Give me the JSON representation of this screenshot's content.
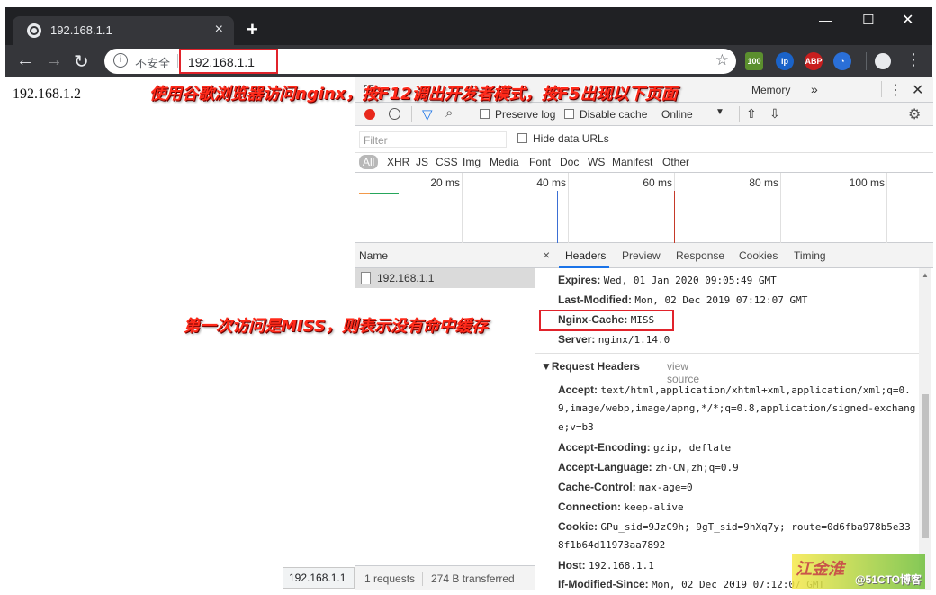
{
  "browser": {
    "tab_title": "192.168.1.1",
    "tab_close": "×",
    "new_tab": "+",
    "win_min": "—",
    "win_max": "☐",
    "win_close": "✕",
    "insecure_label": "不安全",
    "url": "192.168.1.1",
    "star": "☆",
    "ext_labels": [
      "100",
      "ip",
      "ABP",
      "◔"
    ],
    "menu": "⋮",
    "account": "●"
  },
  "page": {
    "content_text": "192.168.1.2",
    "status_link": "192.168.1.1"
  },
  "devtools": {
    "tabs_visible": [
      "Memory",
      "»"
    ],
    "toolbar": {
      "preserve_log": "Preserve log",
      "disable_cache": "Disable cache",
      "throttle": "Online"
    },
    "filter": {
      "placeholder": "Filter",
      "hide_data_urls": "Hide data URLs"
    },
    "types": [
      "All",
      "XHR",
      "JS",
      "CSS",
      "Img",
      "Media",
      "Font",
      "Doc",
      "WS",
      "Manifest",
      "Other"
    ],
    "timeline_ticks": [
      "20 ms",
      "40 ms",
      "60 ms",
      "80 ms",
      "100 ms"
    ],
    "name_header": "Name",
    "request_name": "192.168.1.1",
    "summary_requests": "1 requests",
    "summary_transferred": "274 B transferred",
    "detail_tabs": [
      "Headers",
      "Preview",
      "Response",
      "Cookies",
      "Timing"
    ],
    "response_headers": [
      {
        "key": "Expires:",
        "value": "Wed, 01 Jan 2020 09:05:49 GMT"
      },
      {
        "key": "Last-Modified:",
        "value": "Mon, 02 Dec 2019 07:12:07 GMT"
      },
      {
        "key": "Nginx-Cache:",
        "value": "MISS"
      },
      {
        "key": "Server:",
        "value": "nginx/1.14.0"
      }
    ],
    "request_headers_title": "▼Request Headers",
    "view_source": "view source",
    "request_headers": {
      "accept_key": "Accept:",
      "accept_l1": "text/html,application/xhtml+xml,application/xml;q=0.",
      "accept_l2": "9,image/webp,image/apng,*/*;q=0.8,application/signed-exchang",
      "accept_l3": "e;v=b3",
      "encoding_key": "Accept-Encoding:",
      "encoding_val": "gzip, deflate",
      "language_key": "Accept-Language:",
      "language_val": "zh-CN,zh;q=0.9",
      "cache_key": "Cache-Control:",
      "cache_val": "max-age=0",
      "conn_key": "Connection:",
      "conn_val": "keep-alive",
      "cookie_key": "Cookie:",
      "cookie_l1": "GPu_sid=9JzC9h; 9gT_sid=9hXq7y; route=0d6fba978b5e33",
      "cookie_l2": "8f1b64d11973aa7892",
      "host_key": "Host:",
      "host_val": "192.168.1.1",
      "ims_key": "If-Modified-Since:",
      "ims_val": "Mon, 02 Dec 2019 07:12:07 GMT"
    }
  },
  "annotations": {
    "top": "使用谷歌浏览器访问nginx，按F12调出开发者模式，按F5出现以下页面",
    "middle": "第一次访问是MISS，则表示没有命中缓存"
  },
  "watermark": {
    "logo": "江金淮",
    "site": "@51CTO博客"
  }
}
